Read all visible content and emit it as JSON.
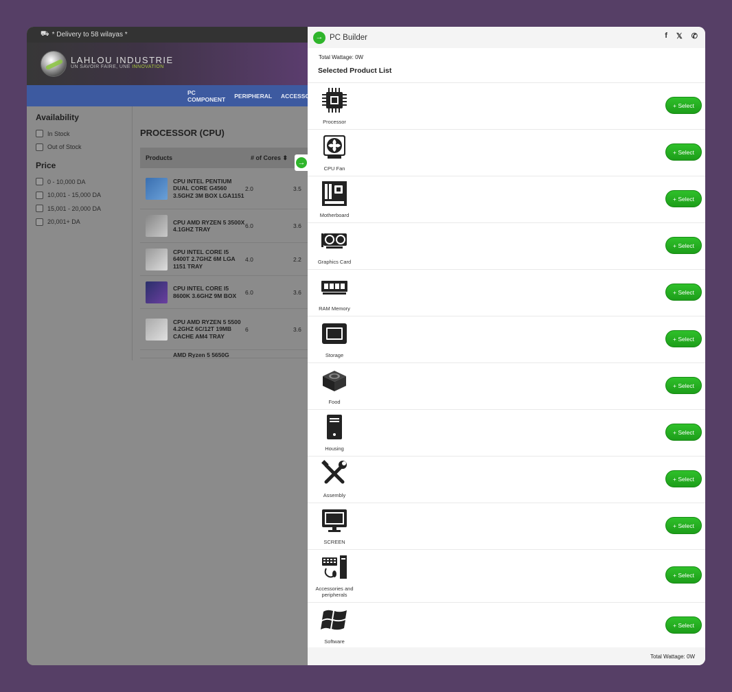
{
  "topbar": {
    "delivery": "* Delivery to 58 wilayas *"
  },
  "logo": {
    "name": "LAHLOU INDUSTRIE",
    "tagline": "UN SAVOIR FAIRE, UNE ",
    "tagline_accent": "INNOVATION"
  },
  "nav": {
    "items": [
      "PC COMPONENT",
      "PERIPHERAL",
      "ACCESSO"
    ]
  },
  "filters": {
    "availability_title": "Availability",
    "availability": [
      "In Stock",
      "Out of Stock"
    ],
    "price_title": "Price",
    "price": [
      "0 - 10,000 DA",
      "10,001 - 15,000 DA",
      "15,001 - 20,000 DA",
      "20,001+ DA"
    ]
  },
  "category": {
    "title": "PROCESSOR (CPU)"
  },
  "table": {
    "headers": {
      "products": "Products",
      "cores": "# of Cores"
    },
    "rows": [
      {
        "name": "CPU INTEL PENTIUM DUAL CORE G4560 3.5GHZ 3M BOX LGA1151",
        "cores": "2.0",
        "freq": "3.5"
      },
      {
        "name": "CPU AMD RYZEN 5 3500X 4.1GHZ TRAY",
        "cores": "6.0",
        "freq": "3.6"
      },
      {
        "name": "CPU INTEL CORE I5 6400T 2.7GHZ 6M LGA 1151 TRAY",
        "cores": "4.0",
        "freq": "2.2"
      },
      {
        "name": "CPU INTEL CORE I5 8600K 3.6GHZ 9M BOX",
        "cores": "6.0",
        "freq": "3.6"
      },
      {
        "name": "CPU AMD RYZEN 5 5500 4.2GHZ 6C/12T 19MB CACHE AM4 TRAY",
        "cores": "6",
        "freq": "3.6"
      },
      {
        "name": "AMD Ryzen 5 5650G",
        "cores": "",
        "freq": ""
      }
    ]
  },
  "panel": {
    "title": "PC Builder",
    "wattage_top": "Total Wattage: 0W",
    "list_title": "Selected Product List",
    "select_label": "+ Select",
    "wattage_bottom": "Total Wattage: 0W",
    "social": [
      "f",
      "𝕏",
      "✆"
    ],
    "items": [
      {
        "label": "Processor",
        "icon": "cpu-icon"
      },
      {
        "label": "CPU Fan",
        "icon": "fan-icon"
      },
      {
        "label": "Motherboard",
        "icon": "motherboard-icon"
      },
      {
        "label": "Graphics Card",
        "icon": "gpu-icon"
      },
      {
        "label": "RAM Memory",
        "icon": "ram-icon"
      },
      {
        "label": "Storage",
        "icon": "storage-icon"
      },
      {
        "label": "Food",
        "icon": "psu-icon"
      },
      {
        "label": "Housing",
        "icon": "case-icon"
      },
      {
        "label": "Assembly",
        "icon": "tools-icon"
      },
      {
        "label": "SCREEN",
        "icon": "monitor-icon"
      },
      {
        "label": "Accessories and peripherals",
        "icon": "peripherals-icon"
      },
      {
        "label": "Software",
        "icon": "windows-icon"
      }
    ]
  }
}
